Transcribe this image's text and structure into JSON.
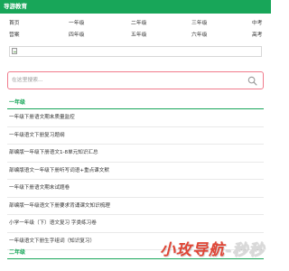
{
  "header": {
    "brand": "导游教育",
    "colors": {
      "brand_green": "#18a659",
      "search_border": "#f07b8c",
      "watermark_red": "#e04535"
    }
  },
  "grade_nav": {
    "rows": [
      [
        "首页",
        "一年级",
        "二年级",
        "三年级",
        "中考"
      ],
      [
        "营案",
        "四年级",
        "五年级",
        "六年级",
        "高考"
      ]
    ]
  },
  "banner": {
    "icon": "broken-image-icon"
  },
  "search": {
    "placeholder": "在这里搜索...",
    "icon": "search-icon"
  },
  "sections": [
    {
      "title": "一年级",
      "items": [
        "一年级下册语文期末质量监控",
        "一年级语文下册复习题纲",
        "部编版一年级下册语文1-8单元知识汇总",
        "部编版语文一年级下册听写词语+重点课文默",
        "一年级下册语文期末试题卷",
        "部编版一年级语文下册要求背诵课文知识梳理",
        "小学一年级（下）语文复习 字类练习卷",
        "一年级语文下册生字组词（知识复习）"
      ]
    },
    {
      "title": "二年级",
      "items": []
    }
  ],
  "watermark": {
    "text_main": "小玫导航",
    "text_tail": "-秒秒"
  }
}
